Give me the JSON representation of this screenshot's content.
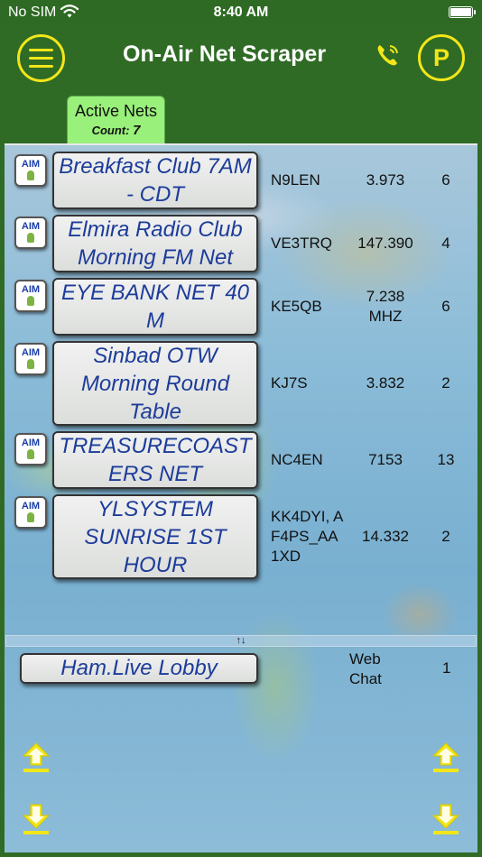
{
  "status_bar": {
    "carrier": "No SIM",
    "time": "8:40 AM"
  },
  "header": {
    "title": "On-Air Net Scraper",
    "menu_icon": "hamburger-menu-icon",
    "phone_icon": "phone-call-icon",
    "p_button_label": "P",
    "accent_color": "#f2e61a",
    "background_color": "#2f6b25"
  },
  "tabs": {
    "active": {
      "label": "Active Nets",
      "count_label": "Count:",
      "count": "7"
    }
  },
  "nets": [
    {
      "badge": "AIM",
      "name": "Breakfast Club 7AM - CDT",
      "callsign": "N9LEN",
      "frequency": "3.973",
      "count": "6"
    },
    {
      "badge": "AIM",
      "name": "Elmira Radio Club Morning FM Net",
      "callsign": "VE3TRQ",
      "frequency": "147.390",
      "count": "4"
    },
    {
      "badge": "AIM",
      "name": "EYE BANK NET 40 M",
      "callsign": "KE5QB",
      "frequency": "7.238 MHZ",
      "count": "6"
    },
    {
      "badge": "AIM",
      "name": "Sinbad OTW Morning Round Table",
      "callsign": "KJ7S",
      "frequency": "3.832",
      "count": "2"
    },
    {
      "badge": "AIM",
      "name": "TREASURECOASTERS NET",
      "callsign": "NC4EN",
      "frequency": "7153",
      "count": "13"
    },
    {
      "badge": "AIM",
      "name": "YLSYSTEM SUNRISE 1ST HOUR",
      "callsign": "KK4DYI, AF4PS_AA1XD",
      "frequency": "14.332",
      "count": "2"
    }
  ],
  "divider": {
    "label": "↑↓"
  },
  "lobby": {
    "name": "Ham.Live Lobby",
    "type_label": "Web Chat",
    "count": "1"
  },
  "scroll": {
    "up_icon": "scroll-up-arrow-icon",
    "down_icon": "scroll-down-arrow-icon"
  }
}
